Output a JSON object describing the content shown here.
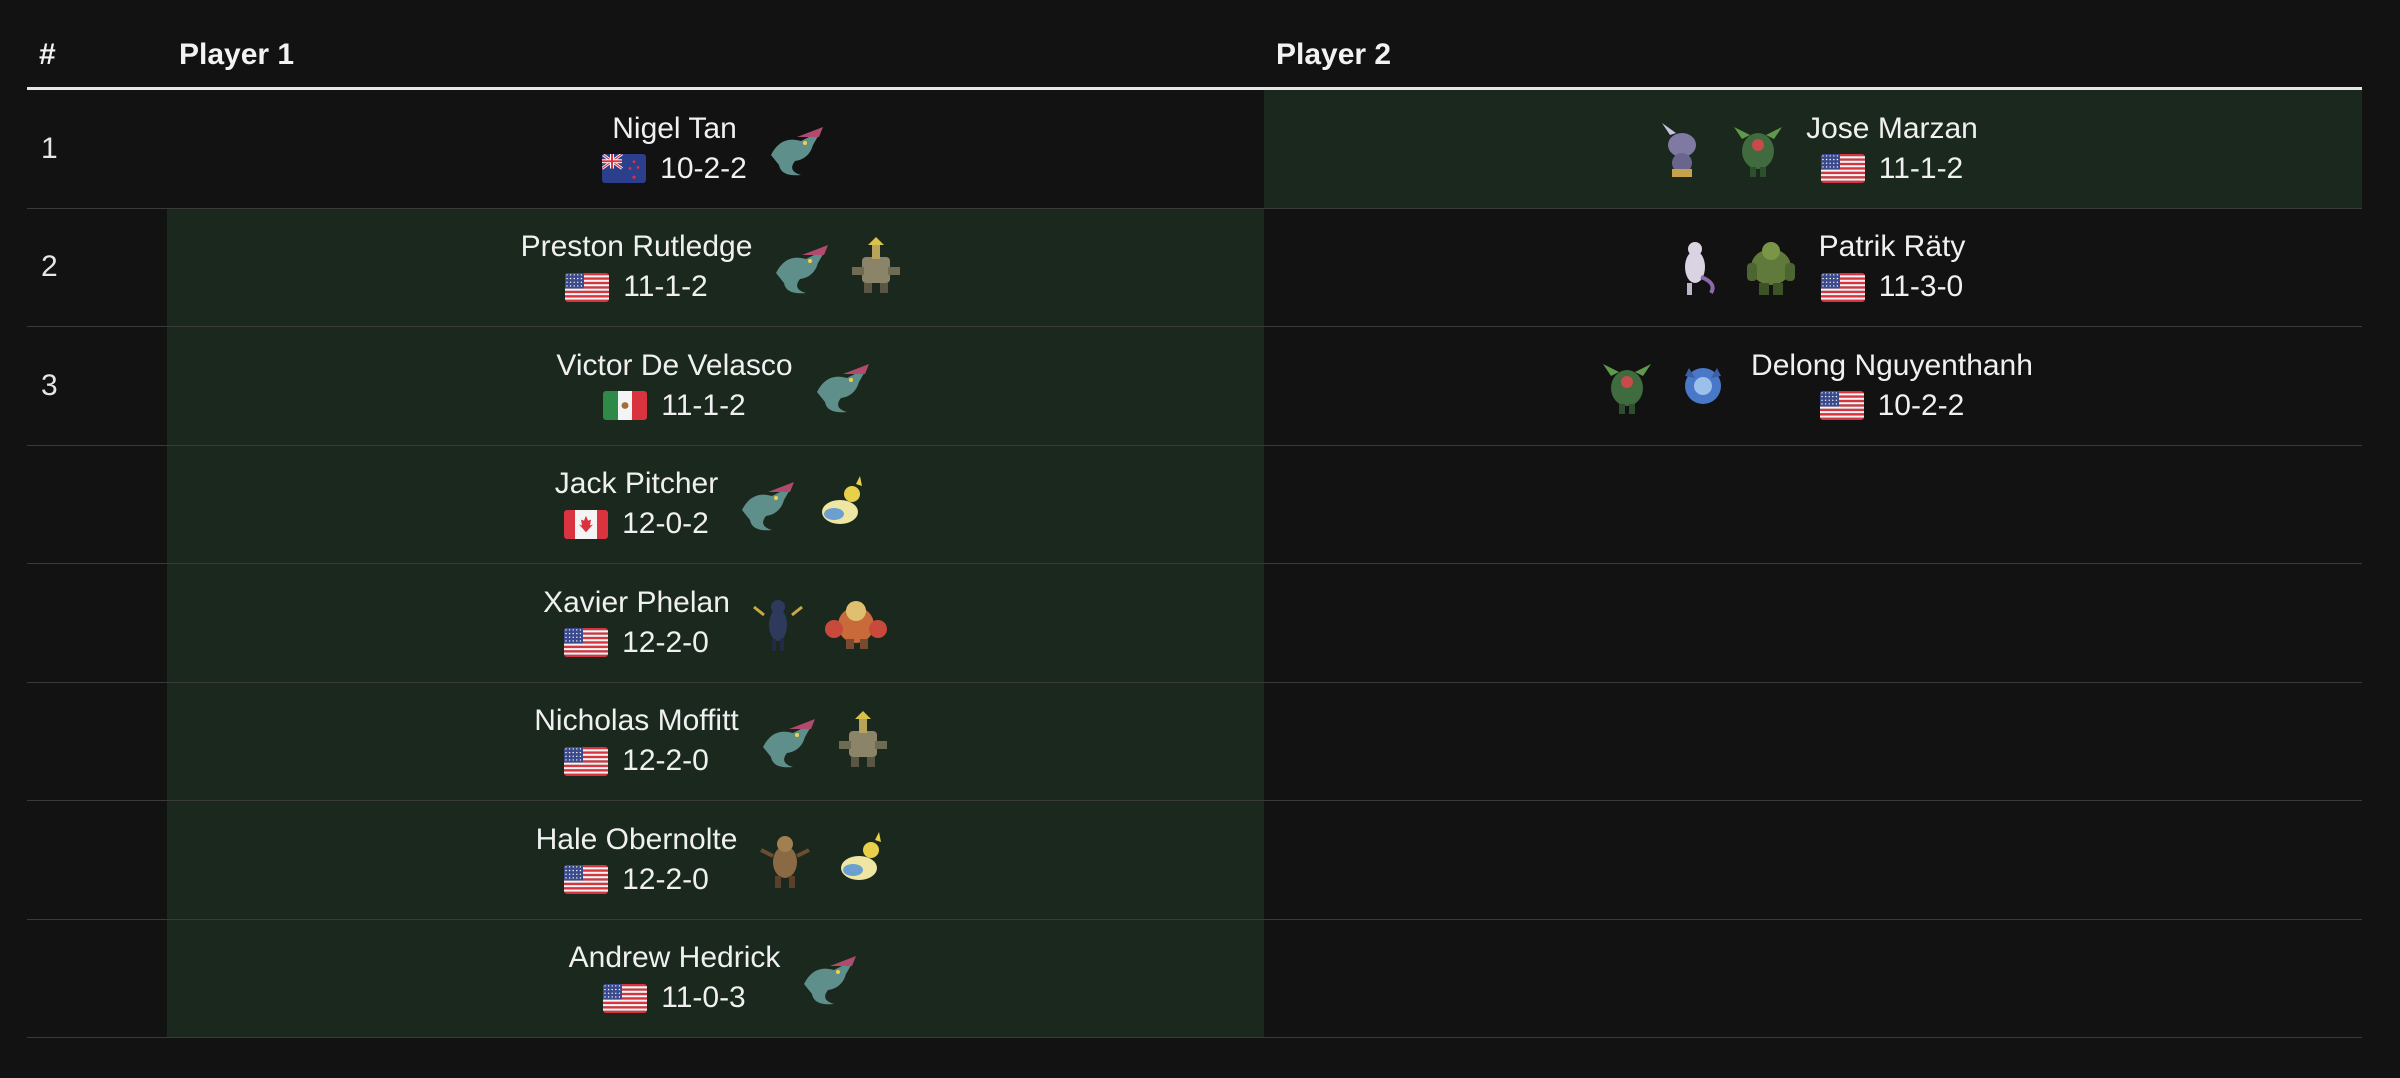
{
  "header": {
    "num": "#",
    "player1": "Player 1",
    "player2": "Player 2"
  },
  "rows": [
    {
      "num": "1",
      "winner": "p2",
      "p1": {
        "name": "Nigel Tan",
        "flag": "nz",
        "record": "10-2-2",
        "sprites": [
          "dragapult-icon"
        ]
      },
      "p2": {
        "name": "Jose Marzan",
        "flag": "us",
        "record": "11-1-2",
        "sprites": [
          "pokemon-purple-icon",
          "pokemon-green-grass-icon"
        ]
      }
    },
    {
      "num": "2",
      "winner": "p1",
      "p1": {
        "name": "Preston Rutledge",
        "flag": "us",
        "record": "11-1-2",
        "sprites": [
          "dragapult-icon",
          "pokemon-gold-stone-icon"
        ]
      },
      "p2": {
        "name": "Patrik Räty",
        "flag": "us",
        "record": "11-3-0",
        "sprites": [
          "mewtwo-icon",
          "pokemon-green-golem-icon"
        ]
      }
    },
    {
      "num": "3",
      "winner": "p1",
      "p1": {
        "name": "Victor De Velasco",
        "flag": "mx",
        "record": "11-1-2",
        "sprites": [
          "dragapult-icon"
        ]
      },
      "p2": {
        "name": "Delong Nguyenthanh",
        "flag": "us",
        "record": "10-2-2",
        "sprites": [
          "pokemon-green-grass-icon",
          "pokemon-blue-icon"
        ]
      }
    },
    {
      "num": "",
      "winner": "p1",
      "p1": {
        "name": "Jack Pitcher",
        "flag": "ca",
        "record": "12-0-2",
        "sprites": [
          "dragapult-icon",
          "pokemon-yellow-icon"
        ]
      },
      "p2": null
    },
    {
      "num": "",
      "winner": "p1",
      "p1": {
        "name": "Xavier Phelan",
        "flag": "us",
        "record": "12-2-0",
        "sprites": [
          "pokemon-dark-blue-icon",
          "pokemon-orange-fighter-icon"
        ]
      },
      "p2": null
    },
    {
      "num": "",
      "winner": "p1",
      "p1": {
        "name": "Nicholas Moffitt",
        "flag": "us",
        "record": "12-2-0",
        "sprites": [
          "dragapult-icon",
          "pokemon-gold-stone-icon"
        ]
      },
      "p2": null
    },
    {
      "num": "",
      "winner": "p1",
      "p1": {
        "name": "Hale Obernolte",
        "flag": "us",
        "record": "12-2-0",
        "sprites": [
          "pokemon-brown-icon",
          "pokemon-yellow-icon"
        ]
      },
      "p2": null
    },
    {
      "num": "",
      "winner": "p1",
      "p1": {
        "name": "Andrew Hedrick",
        "flag": "us",
        "record": "11-0-3",
        "sprites": [
          "dragapult-icon"
        ]
      },
      "p2": null
    }
  ]
}
